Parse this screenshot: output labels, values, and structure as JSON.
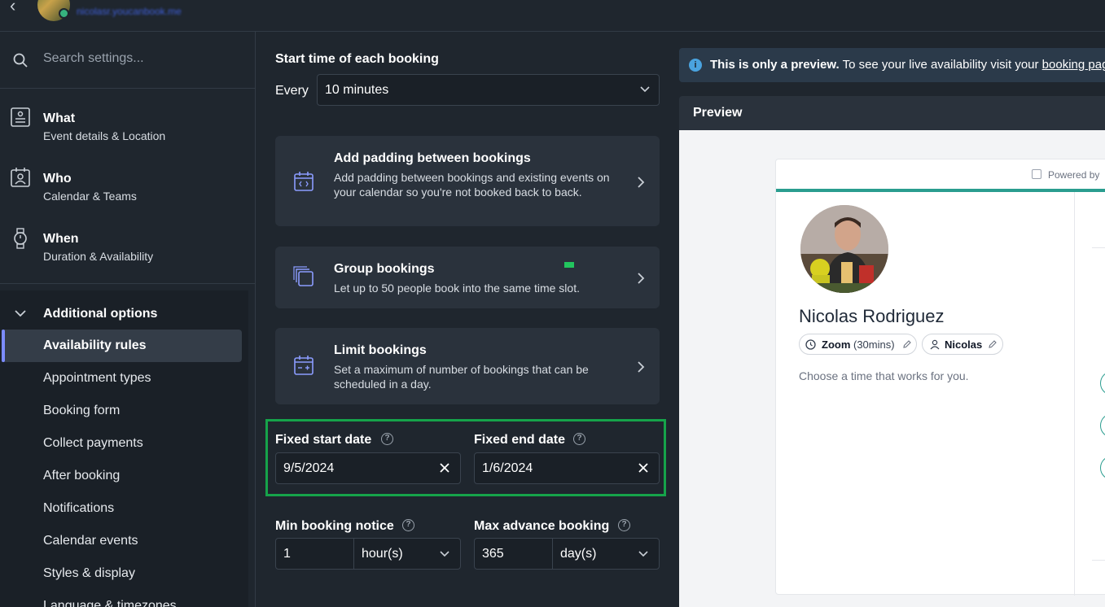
{
  "topbar": {
    "back_icon": "chevron-left-icon",
    "subtitle": "nicolasr.youcanbook.me"
  },
  "sidebar": {
    "search_placeholder": "Search settings...",
    "nav": [
      {
        "title": "What",
        "subtitle": "Event details & Location",
        "icon": "id-card-icon"
      },
      {
        "title": "Who",
        "subtitle": "Calendar & Teams",
        "icon": "calendar-person-icon"
      },
      {
        "title": "When",
        "subtitle": "Duration & Availability",
        "icon": "watch-icon"
      }
    ],
    "additional": {
      "title": "Additional options",
      "items": [
        "Availability rules",
        "Appointment types",
        "Booking form",
        "Collect payments",
        "After booking",
        "Notifications",
        "Calendar events",
        "Styles & display",
        "Language & timezones"
      ],
      "active": "Availability rules"
    }
  },
  "middle": {
    "start_time_label": "Start time of each booking",
    "every_label": "Every",
    "interval_value": "10 minutes",
    "cards": [
      {
        "title": "Add padding between bookings",
        "desc": "Add padding between bookings and existing events on your calendar so you're not booked back to back."
      },
      {
        "title": "Group bookings",
        "desc": "Let up to 50 people book into the same time slot."
      },
      {
        "title": "Limit bookings",
        "desc": "Set a maximum of number of bookings that can be scheduled in a day."
      }
    ],
    "fixed_start_label": "Fixed start date",
    "fixed_start_value": "9/5/2024",
    "fixed_end_label": "Fixed end date",
    "fixed_end_value": "1/6/2024",
    "min_notice_label": "Min booking notice",
    "min_notice_value": "1",
    "min_notice_unit": "hour(s)",
    "max_advance_label": "Max advance booking",
    "max_advance_value": "365",
    "max_advance_unit": "day(s)"
  },
  "preview": {
    "info_bold": "This is only a preview.",
    "info_text": " To see your live availability visit your ",
    "info_link": "booking page",
    "header": "Preview",
    "powered": "Powered by",
    "name": "Nicolas Rodriguez",
    "zoom_label": "Zoom",
    "zoom_duration": "(30mins)",
    "host": "Nicolas",
    "choose_text": "Choose a time that works for you."
  },
  "colors": {
    "accent": "#7c8cff",
    "highlight": "#16a34a",
    "teal": "#2a9d8f"
  }
}
